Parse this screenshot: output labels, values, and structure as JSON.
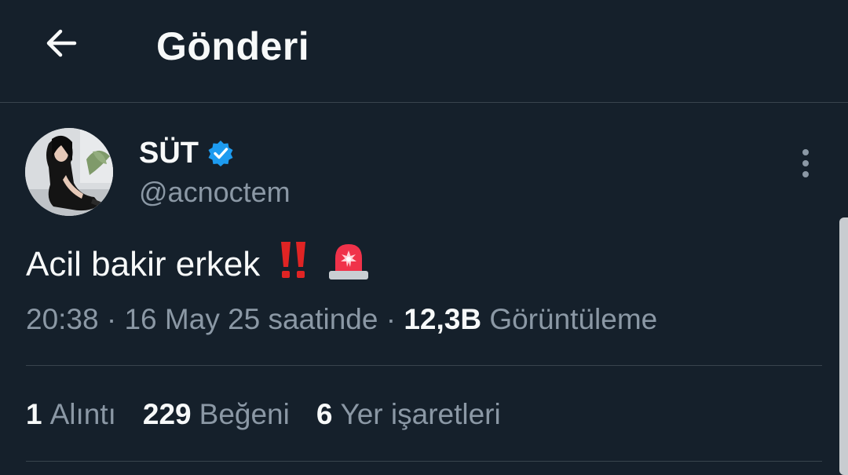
{
  "header": {
    "title": "Gönderi",
    "back_icon": "arrow-left-icon"
  },
  "author": {
    "display_name": "SÜT",
    "handle": "@acnoctem",
    "verified_icon": "verified-badge-icon",
    "verified_color": "#1d9bf0"
  },
  "post": {
    "text": "Acil bakir erkek",
    "emojis": [
      "double-exclamation-icon",
      "police-light-icon"
    ],
    "time": "20:38",
    "date_text": "16 May 25 saatinde",
    "separator": "·",
    "views_count": "12,3B",
    "views_label": "Görüntüleme"
  },
  "stats": {
    "quotes_count": "1",
    "quotes_label": "Alıntı",
    "likes_count": "229",
    "likes_label": "Beğeni",
    "bookmarks_count": "6",
    "bookmarks_label": "Yer işaretleri"
  },
  "colors": {
    "background": "#15202b",
    "text_primary": "#f7f9f9",
    "text_secondary": "#8b98a5",
    "divider": "#38444d"
  }
}
